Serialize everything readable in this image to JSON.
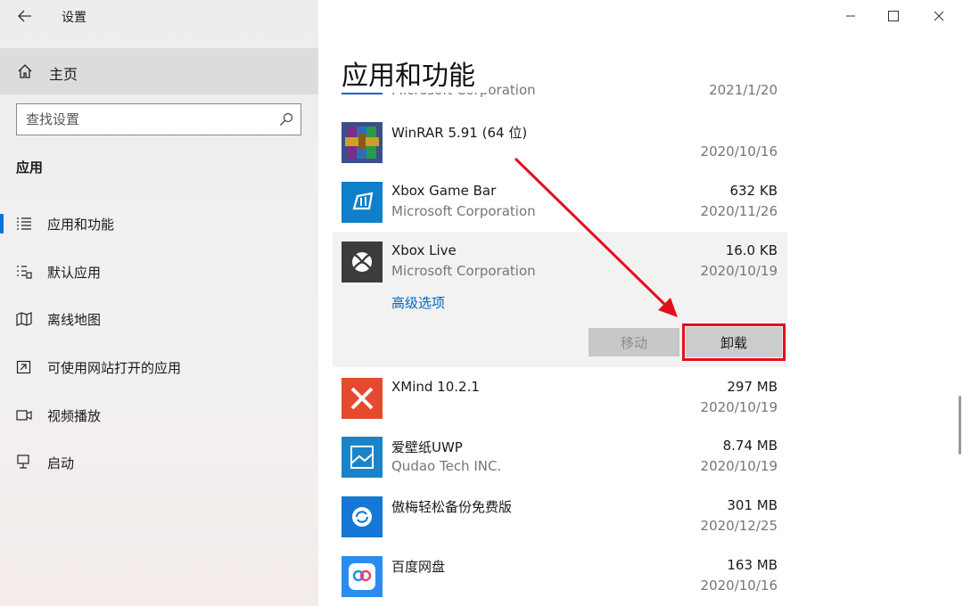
{
  "window": {
    "title": "设置"
  },
  "sidebar": {
    "home_label": "主页",
    "search_placeholder": "查找设置",
    "section_title": "应用",
    "items": [
      {
        "label": "应用和功能",
        "icon": "apps-list-icon",
        "active": true
      },
      {
        "label": "默认应用",
        "icon": "default-apps-icon",
        "active": false
      },
      {
        "label": "离线地图",
        "icon": "offline-map-icon",
        "active": false
      },
      {
        "label": "可使用网站打开的应用",
        "icon": "website-apps-icon",
        "active": false
      },
      {
        "label": "视频播放",
        "icon": "video-playback-icon",
        "active": false
      },
      {
        "label": "启动",
        "icon": "startup-icon",
        "active": false
      }
    ]
  },
  "main": {
    "title": "应用和功能",
    "partial_app": {
      "publisher": "Microsoft Corporation",
      "date": "2021/1/20"
    },
    "apps": [
      {
        "name": "WinRAR 5.91 (64 位)",
        "publisher": "",
        "size": "",
        "date": "2020/10/16",
        "icon": "winrar-icon"
      },
      {
        "name": "Xbox Game Bar",
        "publisher": "Microsoft Corporation",
        "size": "632 KB",
        "date": "2020/11/26",
        "icon": "xbox-game-bar-icon"
      },
      {
        "name": "Xbox Live",
        "publisher": "Microsoft Corporation",
        "size": "16.0 KB",
        "date": "2020/10/19",
        "icon": "xbox-live-icon",
        "advanced_options": "高级选项",
        "move_label": "移动",
        "uninstall_label": "卸载"
      },
      {
        "name": "XMind 10.2.1",
        "publisher": "",
        "size": "297 MB",
        "date": "2020/10/19",
        "icon": "xmind-icon"
      },
      {
        "name": "爱壁纸UWP",
        "publisher": "Qudao Tech INC.",
        "size": "8.74 MB",
        "date": "2020/10/19",
        "icon": "aibizhi-icon"
      },
      {
        "name": "傲梅轻松备份免费版",
        "publisher": "",
        "size": "301 MB",
        "date": "2020/12/25",
        "icon": "aomei-backup-icon"
      },
      {
        "name": "百度网盘",
        "publisher": "",
        "size": "163 MB",
        "date": "2020/10/16",
        "icon": "baidu-netdisk-icon"
      }
    ]
  },
  "colors": {
    "accent": "#0078d7",
    "highlight": "#e3101b",
    "link": "#0067c0"
  }
}
